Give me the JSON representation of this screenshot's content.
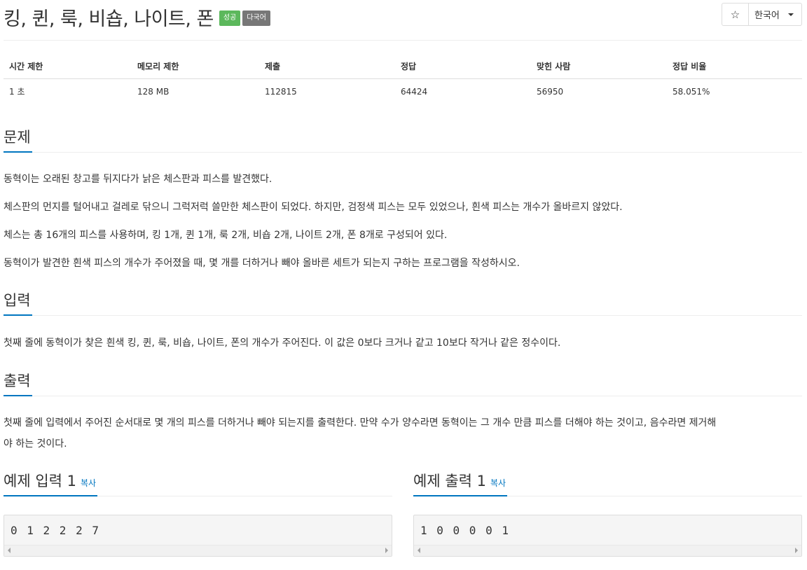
{
  "problem": {
    "title": "킹, 퀸, 룩, 비숍, 나이트, 폰",
    "badge_success": "성공",
    "badge_multilang": "다국어"
  },
  "controls": {
    "star": "☆",
    "language": "한국어"
  },
  "info_table": {
    "headers": [
      "시간 제한",
      "메모리 제한",
      "제출",
      "정답",
      "맞힌 사람",
      "정답 비율"
    ],
    "values": [
      "1 초",
      "128 MB",
      "112815",
      "64424",
      "56950",
      "58.051%"
    ]
  },
  "sections": {
    "problem_heading": "문제",
    "problem_paragraphs": [
      "동혁이는 오래된 창고를 뒤지다가 낡은 체스판과 피스를 발견했다.",
      "체스판의 먼지를 털어내고 걸레로 닦으니 그럭저럭 쓸만한 체스판이 되었다. 하지만, 검정색 피스는 모두 있었으나, 흰색 피스는 개수가 올바르지 않았다.",
      "체스는 총 16개의 피스를 사용하며, 킹 1개, 퀸 1개, 룩 2개, 비숍 2개, 나이트 2개, 폰 8개로 구성되어 있다.",
      "동혁이가 발견한 흰색 피스의 개수가 주어졌을 때, 몇 개를 더하거나 빼야 올바른 세트가 되는지 구하는 프로그램을 작성하시오."
    ],
    "input_heading": "입력",
    "input_text": "첫째 줄에 동혁이가 찾은 흰색 킹, 퀸, 룩, 비숍, 나이트, 폰의 개수가 주어진다. 이 값은 0보다 크거나 같고 10보다 작거나 같은 정수이다.",
    "output_heading": "출력",
    "output_text_line1": "첫째 줄에 입력에서 주어진 순서대로 몇 개의 피스를 더하거나 빼야 되는지를 출력한다. 만약 수가 양수라면 동혁이는 그 개수 만큼 피스를 더해야 하는 것이고, 음수라면 제거해",
    "output_text_line2": "야 하는 것이다."
  },
  "samples": {
    "input_heading": "예제 입력 1",
    "output_heading": "예제 출력 1",
    "copy_label": "복사",
    "input_value": "0 1 2 2 2 7",
    "output_value": "1 0 0 0 0 1"
  }
}
